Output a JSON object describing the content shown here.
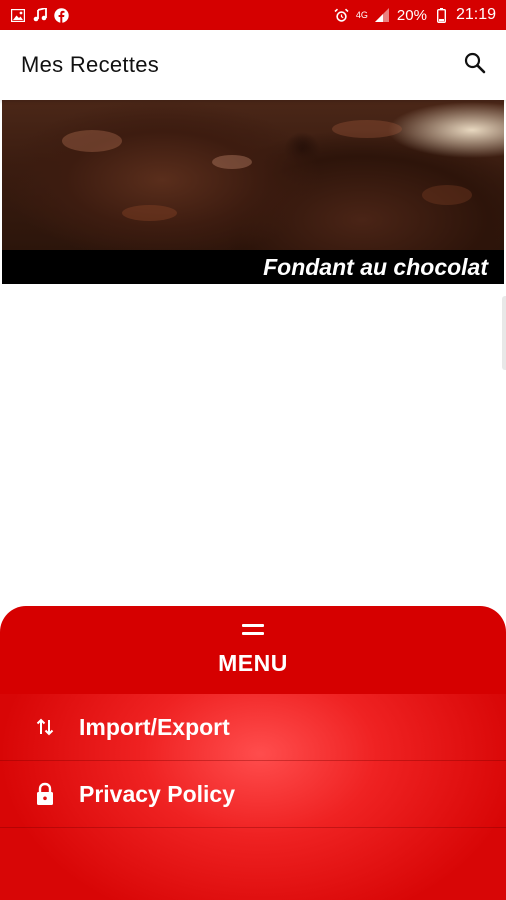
{
  "status_bar": {
    "battery": "20%",
    "time": "21:19",
    "network": "4G",
    "icons": [
      "image-icon",
      "music-note-icon",
      "facebook-icon",
      "alarm-icon",
      "signal-icon",
      "battery-icon"
    ]
  },
  "app_bar": {
    "title": "Mes Recettes",
    "search_icon": "search-icon"
  },
  "recipes": [
    {
      "name": "Fondant au chocolat"
    }
  ],
  "menu": {
    "title": "MENU",
    "items": [
      {
        "label": "Import/Export",
        "icon": "swap-vertical-icon"
      },
      {
        "label": "Privacy Policy",
        "icon": "lock-icon"
      }
    ]
  },
  "colors": {
    "primary": "#d50000",
    "menu_highlight": "#ff4d4d",
    "caption_bg": "#000000"
  }
}
